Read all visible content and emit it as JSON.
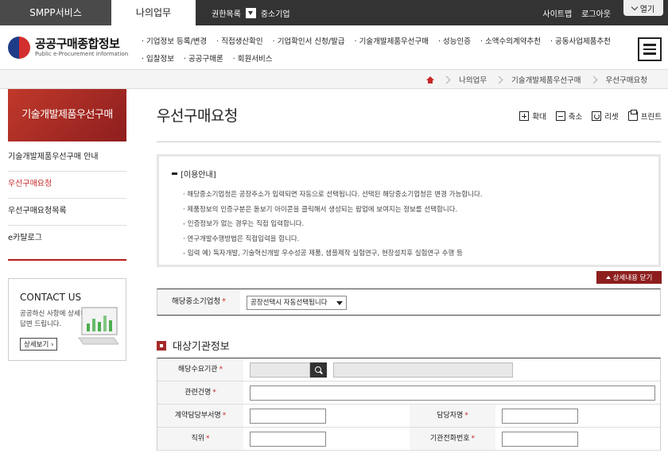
{
  "topbar": {
    "tab_smpp": "SMPP서비스",
    "tab_my": "나의업무",
    "authority": "권한목록",
    "sme": "중소기업",
    "sitemap": "사이트맵",
    "logout": "로그아웃",
    "open": "열기"
  },
  "logo": {
    "ko": "공공구매종합정보",
    "en": "Public e-Procurement information"
  },
  "gnb": {
    "row1": [
      "기업정보 등록/변경",
      "직접생산확인",
      "기업확인서 신청/발급",
      "기술개발제품우선구매",
      "성능인증",
      "소액수의계약추천",
      "공동사업제품추천"
    ],
    "row2": [
      "입찰정보",
      "공공구매론",
      "회원서비스"
    ]
  },
  "breadcrumb": [
    "나의업무",
    "기술개발제품우선구매",
    "우선구매요청"
  ],
  "sidebar": {
    "banner": "기술개발제품우선구매",
    "items": [
      "기술개발제품우선구매 안내",
      "우선구매요청",
      "우선구매요청목록",
      "e카탈로그"
    ],
    "active_index": 1
  },
  "contact": {
    "title": "CONTACT US",
    "desc": "공공하신 사항에 상세히 답변 드립니다.",
    "button": "상세보기"
  },
  "main": {
    "title": "우선구매요청",
    "tools": {
      "zoom_in": "확대",
      "zoom_out": "축소",
      "reset": "리셋",
      "print": "프린트"
    }
  },
  "info": {
    "title": "[이용안내]",
    "lines": [
      "· 해당중소기업청은 공장주소가 입력되면 자동으로 선택됩니다. 선택된 해당중소기업청은 변경 가능합니다.",
      "· 제품정보의 인증구분은 돋보기 아이콘을 클릭해서 생성되는 팝업에 보여지는 정보를 선택합니다.",
      "  - 인증정보가 없는 경우는 직접 입력합니다.",
      "· 연구개발수행방법은 직접입력을 합니다.",
      "  - 입력 예) 독자개발, 기술혁신개발 우수성공 제품, 샘플제작 실험연구, 현장설치후 실험연구 수행 등"
    ],
    "more_button": "상세내용 닫기"
  },
  "company": {
    "label": "해당중소기업청",
    "select_value": "공장선택시 자동선택됩니다"
  },
  "section": {
    "title": "대상기관정보",
    "fields": {
      "demand_agency": "해당수요기관",
      "project_name": "관련건명",
      "contract_dept": "계약담당부서명",
      "manager_name": "담당자명",
      "position": "직위",
      "agency_phone": "기관전화번호"
    }
  },
  "required_mark": "*"
}
